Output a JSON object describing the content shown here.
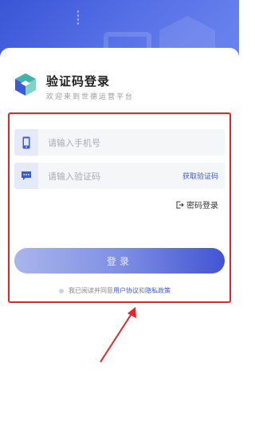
{
  "header": {
    "title": "验证码登录",
    "subtitle": "欢迎来到世德运营平台"
  },
  "form": {
    "phone_placeholder": "请输入手机号",
    "code_placeholder": "请输入验证码",
    "get_code_label": "获取验证码",
    "password_login_label": "密码登录",
    "login_button_label": "登录"
  },
  "agreement": {
    "prefix": "我已阅读并同意",
    "user_agreement": "用户协议",
    "and": "和",
    "privacy_policy": "隐私政策"
  },
  "icons": {
    "phone": "phone-icon",
    "sms": "sms-icon",
    "exit": "exit-icon",
    "logo": "logo-icon"
  },
  "colors": {
    "accent": "#3a5bd8",
    "highlight": "#e4262a",
    "hero_start": "#3a55d6",
    "hero_end": "#6c86ee"
  }
}
